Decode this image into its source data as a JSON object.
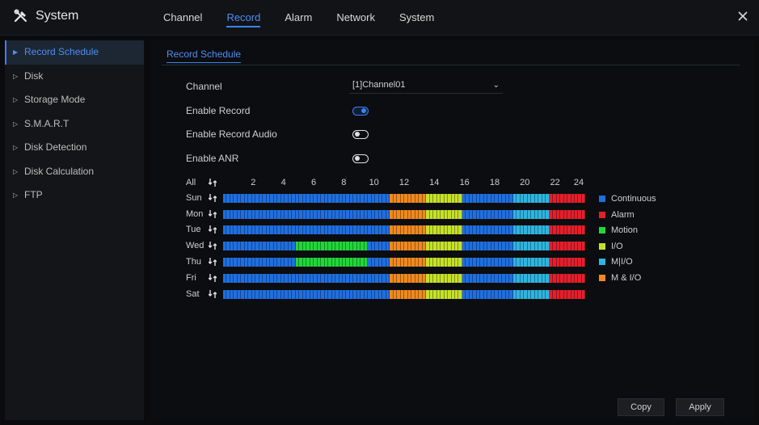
{
  "header": {
    "title": "System",
    "tabs": [
      {
        "label": "Channel",
        "active": false
      },
      {
        "label": "Record",
        "active": true
      },
      {
        "label": "Alarm",
        "active": false
      },
      {
        "label": "Network",
        "active": false
      },
      {
        "label": "System",
        "active": false
      }
    ]
  },
  "sidebar": {
    "items": [
      {
        "label": "Record Schedule",
        "active": true
      },
      {
        "label": "Disk",
        "active": false
      },
      {
        "label": "Storage Mode",
        "active": false
      },
      {
        "label": "S.M.A.R.T",
        "active": false
      },
      {
        "label": "Disk Detection",
        "active": false
      },
      {
        "label": "Disk Calculation",
        "active": false
      },
      {
        "label": "FTP",
        "active": false
      }
    ]
  },
  "panel": {
    "subtab": "Record Schedule",
    "channel_label": "Channel",
    "channel_value": "[1]Channel01",
    "enable_record_label": "Enable Record",
    "enable_record_on": true,
    "enable_audio_label": "Enable Record Audio",
    "enable_audio_on": false,
    "enable_anr_label": "Enable ANR",
    "enable_anr_on": false
  },
  "schedule": {
    "all_label": "All",
    "hour_labels": [
      "2",
      "4",
      "6",
      "8",
      "10",
      "12",
      "14",
      "16",
      "18",
      "20",
      "22",
      "24"
    ],
    "days": [
      {
        "label": "Sun",
        "blocks": [
          "C",
          "C",
          "C",
          "C",
          "C",
          "C",
          "C",
          "C",
          "C",
          "C",
          "C",
          "C",
          "C",
          "C",
          "C",
          "C",
          "C",
          "C",
          "C",
          "C",
          "C",
          "C",
          "C",
          "C",
          "C",
          "C",
          "C",
          "C",
          "C",
          "C",
          "C",
          "C",
          "C",
          "C",
          "C",
          "C",
          "C",
          "C",
          "C",
          "C",
          "C",
          "C",
          "C",
          "C",
          "C",
          "C",
          "M",
          "M",
          "M",
          "M",
          "M",
          "M",
          "M",
          "M",
          "M",
          "M",
          "I",
          "I",
          "I",
          "I",
          "I",
          "I",
          "I",
          "I",
          "I",
          "I",
          "C",
          "C",
          "C",
          "C",
          "C",
          "C",
          "C",
          "C",
          "C",
          "C",
          "C",
          "C",
          "C",
          "C",
          "O",
          "O",
          "O",
          "O",
          "O",
          "O",
          "O",
          "O",
          "O",
          "O",
          "A",
          "A",
          "A",
          "A",
          "A",
          "A",
          "A",
          "A",
          "A",
          "A"
        ]
      },
      {
        "label": "Mon",
        "blocks": [
          "C",
          "C",
          "C",
          "C",
          "C",
          "C",
          "C",
          "C",
          "C",
          "C",
          "C",
          "C",
          "C",
          "C",
          "C",
          "C",
          "C",
          "C",
          "C",
          "C",
          "C",
          "C",
          "C",
          "C",
          "C",
          "C",
          "C",
          "C",
          "C",
          "C",
          "C",
          "C",
          "C",
          "C",
          "C",
          "C",
          "C",
          "C",
          "C",
          "C",
          "C",
          "C",
          "C",
          "C",
          "C",
          "C",
          "M",
          "M",
          "M",
          "M",
          "M",
          "M",
          "M",
          "M",
          "M",
          "M",
          "I",
          "I",
          "I",
          "I",
          "I",
          "I",
          "I",
          "I",
          "I",
          "I",
          "C",
          "C",
          "C",
          "C",
          "C",
          "C",
          "C",
          "C",
          "C",
          "C",
          "C",
          "C",
          "C",
          "C",
          "O",
          "O",
          "O",
          "O",
          "O",
          "O",
          "O",
          "O",
          "O",
          "O",
          "A",
          "A",
          "A",
          "A",
          "A",
          "A",
          "A",
          "A",
          "A",
          "A"
        ]
      },
      {
        "label": "Tue",
        "blocks": [
          "C",
          "C",
          "C",
          "C",
          "C",
          "C",
          "C",
          "C",
          "C",
          "C",
          "C",
          "C",
          "C",
          "C",
          "C",
          "C",
          "C",
          "C",
          "C",
          "C",
          "C",
          "C",
          "C",
          "C",
          "C",
          "C",
          "C",
          "C",
          "C",
          "C",
          "C",
          "C",
          "C",
          "C",
          "C",
          "C",
          "C",
          "C",
          "C",
          "C",
          "C",
          "C",
          "C",
          "C",
          "C",
          "C",
          "M",
          "M",
          "M",
          "M",
          "M",
          "M",
          "M",
          "M",
          "M",
          "M",
          "I",
          "I",
          "I",
          "I",
          "I",
          "I",
          "I",
          "I",
          "I",
          "I",
          "C",
          "C",
          "C",
          "C",
          "C",
          "C",
          "C",
          "C",
          "C",
          "C",
          "C",
          "C",
          "C",
          "C",
          "O",
          "O",
          "O",
          "O",
          "O",
          "O",
          "O",
          "O",
          "O",
          "O",
          "A",
          "A",
          "A",
          "A",
          "A",
          "A",
          "A",
          "A",
          "A",
          "A"
        ]
      },
      {
        "label": "Wed",
        "blocks": [
          "C",
          "C",
          "C",
          "C",
          "C",
          "C",
          "C",
          "C",
          "C",
          "C",
          "C",
          "C",
          "C",
          "C",
          "C",
          "C",
          "C",
          "C",
          "C",
          "C",
          "G",
          "G",
          "G",
          "G",
          "G",
          "G",
          "G",
          "G",
          "G",
          "G",
          "G",
          "G",
          "G",
          "G",
          "G",
          "G",
          "G",
          "G",
          "G",
          "G",
          "C",
          "C",
          "C",
          "C",
          "C",
          "C",
          "M",
          "M",
          "M",
          "M",
          "M",
          "M",
          "M",
          "M",
          "M",
          "M",
          "I",
          "I",
          "I",
          "I",
          "I",
          "I",
          "I",
          "I",
          "I",
          "I",
          "C",
          "C",
          "C",
          "C",
          "C",
          "C",
          "C",
          "C",
          "C",
          "C",
          "C",
          "C",
          "C",
          "C",
          "O",
          "O",
          "O",
          "O",
          "O",
          "O",
          "O",
          "O",
          "O",
          "O",
          "A",
          "A",
          "A",
          "A",
          "A",
          "A",
          "A",
          "A",
          "A",
          "A"
        ]
      },
      {
        "label": "Thu",
        "blocks": [
          "C",
          "C",
          "C",
          "C",
          "C",
          "C",
          "C",
          "C",
          "C",
          "C",
          "C",
          "C",
          "C",
          "C",
          "C",
          "C",
          "C",
          "C",
          "C",
          "C",
          "G",
          "G",
          "G",
          "G",
          "G",
          "G",
          "G",
          "G",
          "G",
          "G",
          "G",
          "G",
          "G",
          "G",
          "G",
          "G",
          "G",
          "G",
          "G",
          "G",
          "C",
          "C",
          "C",
          "C",
          "C",
          "C",
          "M",
          "M",
          "M",
          "M",
          "M",
          "M",
          "M",
          "M",
          "M",
          "M",
          "I",
          "I",
          "I",
          "I",
          "I",
          "I",
          "I",
          "I",
          "I",
          "I",
          "C",
          "C",
          "C",
          "C",
          "C",
          "C",
          "C",
          "C",
          "C",
          "C",
          "C",
          "C",
          "C",
          "C",
          "O",
          "O",
          "O",
          "O",
          "O",
          "O",
          "O",
          "O",
          "O",
          "O",
          "A",
          "A",
          "A",
          "A",
          "A",
          "A",
          "A",
          "A",
          "A",
          "A"
        ]
      },
      {
        "label": "Fri",
        "blocks": [
          "C",
          "C",
          "C",
          "C",
          "C",
          "C",
          "C",
          "C",
          "C",
          "C",
          "C",
          "C",
          "C",
          "C",
          "C",
          "C",
          "C",
          "C",
          "C",
          "C",
          "C",
          "C",
          "C",
          "C",
          "C",
          "C",
          "C",
          "C",
          "C",
          "C",
          "C",
          "C",
          "C",
          "C",
          "C",
          "C",
          "C",
          "C",
          "C",
          "C",
          "C",
          "C",
          "C",
          "C",
          "C",
          "C",
          "M",
          "M",
          "M",
          "M",
          "M",
          "M",
          "M",
          "M",
          "M",
          "M",
          "I",
          "I",
          "I",
          "I",
          "I",
          "I",
          "I",
          "I",
          "I",
          "I",
          "C",
          "C",
          "C",
          "C",
          "C",
          "C",
          "C",
          "C",
          "C",
          "C",
          "C",
          "C",
          "C",
          "C",
          "O",
          "O",
          "O",
          "O",
          "O",
          "O",
          "O",
          "O",
          "O",
          "O",
          "A",
          "A",
          "A",
          "A",
          "A",
          "A",
          "A",
          "A",
          "A",
          "A"
        ]
      },
      {
        "label": "Sat",
        "blocks": [
          "C",
          "C",
          "C",
          "C",
          "C",
          "C",
          "C",
          "C",
          "C",
          "C",
          "C",
          "C",
          "C",
          "C",
          "C",
          "C",
          "C",
          "C",
          "C",
          "C",
          "C",
          "C",
          "C",
          "C",
          "C",
          "C",
          "C",
          "C",
          "C",
          "C",
          "C",
          "C",
          "C",
          "C",
          "C",
          "C",
          "C",
          "C",
          "C",
          "C",
          "C",
          "C",
          "C",
          "C",
          "C",
          "C",
          "M",
          "M",
          "M",
          "M",
          "M",
          "M",
          "M",
          "M",
          "M",
          "M",
          "I",
          "I",
          "I",
          "I",
          "I",
          "I",
          "I",
          "I",
          "I",
          "I",
          "C",
          "C",
          "C",
          "C",
          "C",
          "C",
          "C",
          "C",
          "C",
          "C",
          "C",
          "C",
          "C",
          "C",
          "O",
          "O",
          "O",
          "O",
          "O",
          "O",
          "O",
          "O",
          "O",
          "O",
          "A",
          "A",
          "A",
          "A",
          "A",
          "A",
          "A",
          "A",
          "A",
          "A"
        ]
      }
    ],
    "colors": {
      "C": "#1f6fe0",
      "A": "#e2202c",
      "G": "#22d63a",
      "I": "#c6e02a",
      "O": "#2fb4e0",
      "M": "#f0891f"
    }
  },
  "legend": [
    {
      "label": "Continuous",
      "color": "#1f6fe0"
    },
    {
      "label": "Alarm",
      "color": "#e2202c"
    },
    {
      "label": "Motion",
      "color": "#22d63a"
    },
    {
      "label": "I/O",
      "color": "#c6e02a"
    },
    {
      "label": "M|I/O",
      "color": "#2fb4e0"
    },
    {
      "label": "M & I/O",
      "color": "#f0891f"
    }
  ],
  "buttons": {
    "copy": "Copy",
    "apply": "Apply"
  }
}
